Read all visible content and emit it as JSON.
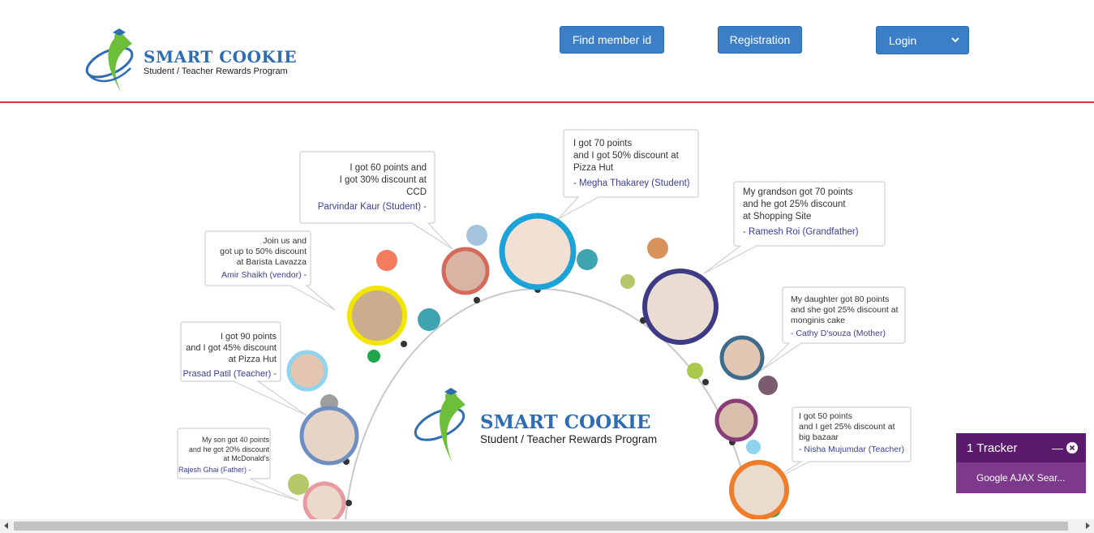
{
  "brand": {
    "title": "SMART COOKIE",
    "subtitle": "Student / Teacher Rewards Program"
  },
  "nav": {
    "find_member": "Find member id",
    "registration": "Registration",
    "login": "Login"
  },
  "banner": {
    "center_title": "SMART COOKIE",
    "center_subtitle": "Student / Teacher Rewards Program",
    "testimonials": [
      {
        "lines": [
          "I got 60 points and",
          "I got 30% discount at",
          "CCD"
        ],
        "who": "Parvindar Kaur (Student) -"
      },
      {
        "lines": [
          "I got 70 points",
          "and I got 50% discount at",
          "Pizza Hut"
        ],
        "who": "- Megha Thakarey (Student)"
      },
      {
        "lines": [
          "My grandson got 70 points",
          "and he got 25% discount",
          "at Shopping Site"
        ],
        "who": "- Ramesh Roi (Grandfather)"
      },
      {
        "lines": [
          "Join us and",
          "got up to 50% discount",
          "at Barista Lavazza"
        ],
        "who": "Amir Shaikh (vendor) -"
      },
      {
        "lines": [
          "My daughter got 80 points",
          "and she got 25% discount at",
          "monginis cake"
        ],
        "who": "- Cathy D'souza (Mother)"
      },
      {
        "lines": [
          "I got 90 points",
          "and I got 45% discount",
          "at Pizza Hut"
        ],
        "who": "Prasad Patil (Teacher) -"
      },
      {
        "lines": [
          "I got 50 points",
          "and I get 25% discount at",
          "big bazaar"
        ],
        "who": "- Nisha Mujumdar (Teacher)"
      },
      {
        "lines": [
          "My son got 40 points",
          "and he got 20% discount",
          "at McDonald's"
        ],
        "who": "Rajesh Ghai (Father) -"
      }
    ]
  },
  "tracker": {
    "title": "1 Tracker",
    "item": "Google AJAX Sear..."
  },
  "colors": {
    "accent": "#3d7fc6",
    "header_rule": "#d9353a",
    "tracker_head": "#5b1a6e",
    "tracker_body": "#7d3a8c"
  }
}
